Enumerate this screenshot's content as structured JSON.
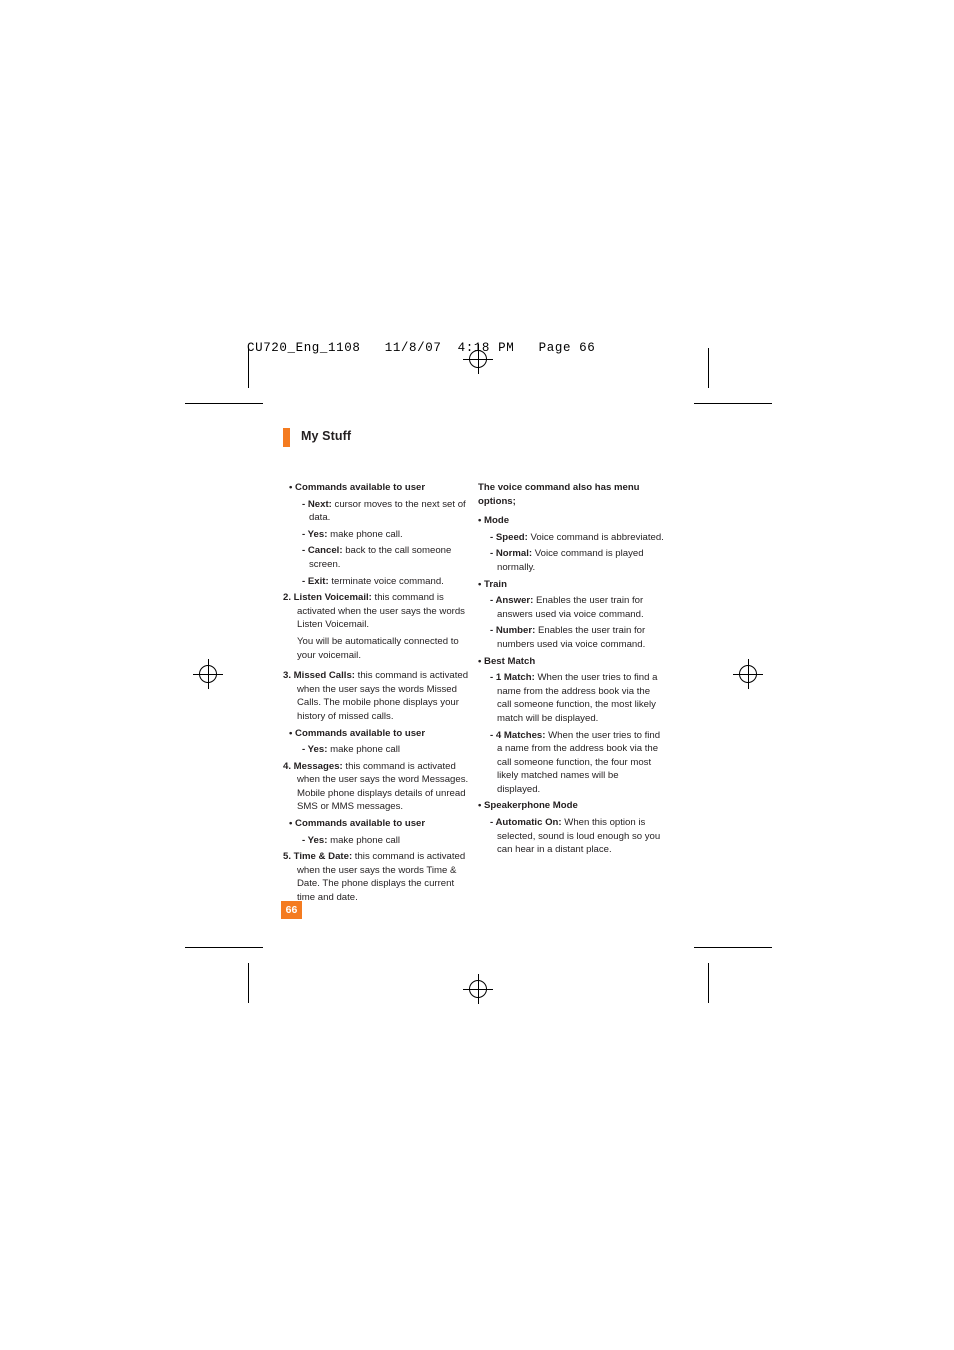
{
  "slug": "CU720_Eng_1108   11/8/07  4:18 PM   Page 66",
  "header": {
    "title": "My Stuff",
    "accent_color": "#f47b20"
  },
  "page_number": "66",
  "left_column": {
    "bullet_commands_1": "• Commands available to user",
    "items_1": [
      {
        "label": "- Next:",
        "text": " cursor moves to the next set of data."
      },
      {
        "label": "- Yes:",
        "text": " make phone call."
      },
      {
        "label": "- Cancel:",
        "text": " back to the call someone screen."
      },
      {
        "label": "- Exit:",
        "text": " terminate voice command."
      }
    ],
    "item_2": {
      "number": "2. ",
      "label": "Listen Voicemail:",
      "text": " this command is activated when the user says the words Listen Voicemail.",
      "cont": "You will be automatically connected to your voicemail."
    },
    "item_3": {
      "number": "3. ",
      "label": "Missed Calls:",
      "text": " this command is activated when the user says the words Missed Calls. The mobile phone displays your history of missed calls."
    },
    "bullet_commands_2": "• Commands available to user",
    "items_2": [
      {
        "label": "- Yes:",
        "text": " make phone call"
      }
    ],
    "item_4": {
      "number": "4. ",
      "label": "Messages:",
      "text": " this command is activated when the user says the word Messages. Mobile phone displays details of unread SMS or MMS messages."
    },
    "bullet_commands_3": "• Commands available to user",
    "items_3": [
      {
        "label": "- Yes:",
        "text": " make phone call"
      }
    ],
    "item_5": {
      "number": "5. ",
      "label": "Time & Date:",
      "text": " this command is activated when the user says the words Time & Date. The phone displays the current time and date."
    }
  },
  "right_column": {
    "intro": "The voice command also has menu options;",
    "groups": [
      {
        "heading": "• Mode",
        "items": [
          {
            "label": "- Speed:",
            "text": " Voice command is abbreviated."
          },
          {
            "label": "- Normal:",
            "text": " Voice command is played normally."
          }
        ]
      },
      {
        "heading": "• Train",
        "items": [
          {
            "label": "- Answer:",
            "text": " Enables the user train for answers used via voice command."
          },
          {
            "label": "- Number:",
            "text": " Enables the user train for numbers used via voice command."
          }
        ]
      },
      {
        "heading": "• Best Match",
        "items": [
          {
            "label": "- 1 Match:",
            "text": " When the user tries to find a name from the address book via the call someone function, the most likely match will be displayed."
          },
          {
            "label": "- 4 Matches:",
            "text": " When the user tries to find a name from the address book via the call someone function, the four most likely matched names will be displayed."
          }
        ]
      },
      {
        "heading": "• Speakerphone Mode",
        "items": [
          {
            "label": "- Automatic On:",
            "text": " When this option is selected, sound is loud enough so you can hear in a distant place."
          }
        ]
      }
    ]
  }
}
